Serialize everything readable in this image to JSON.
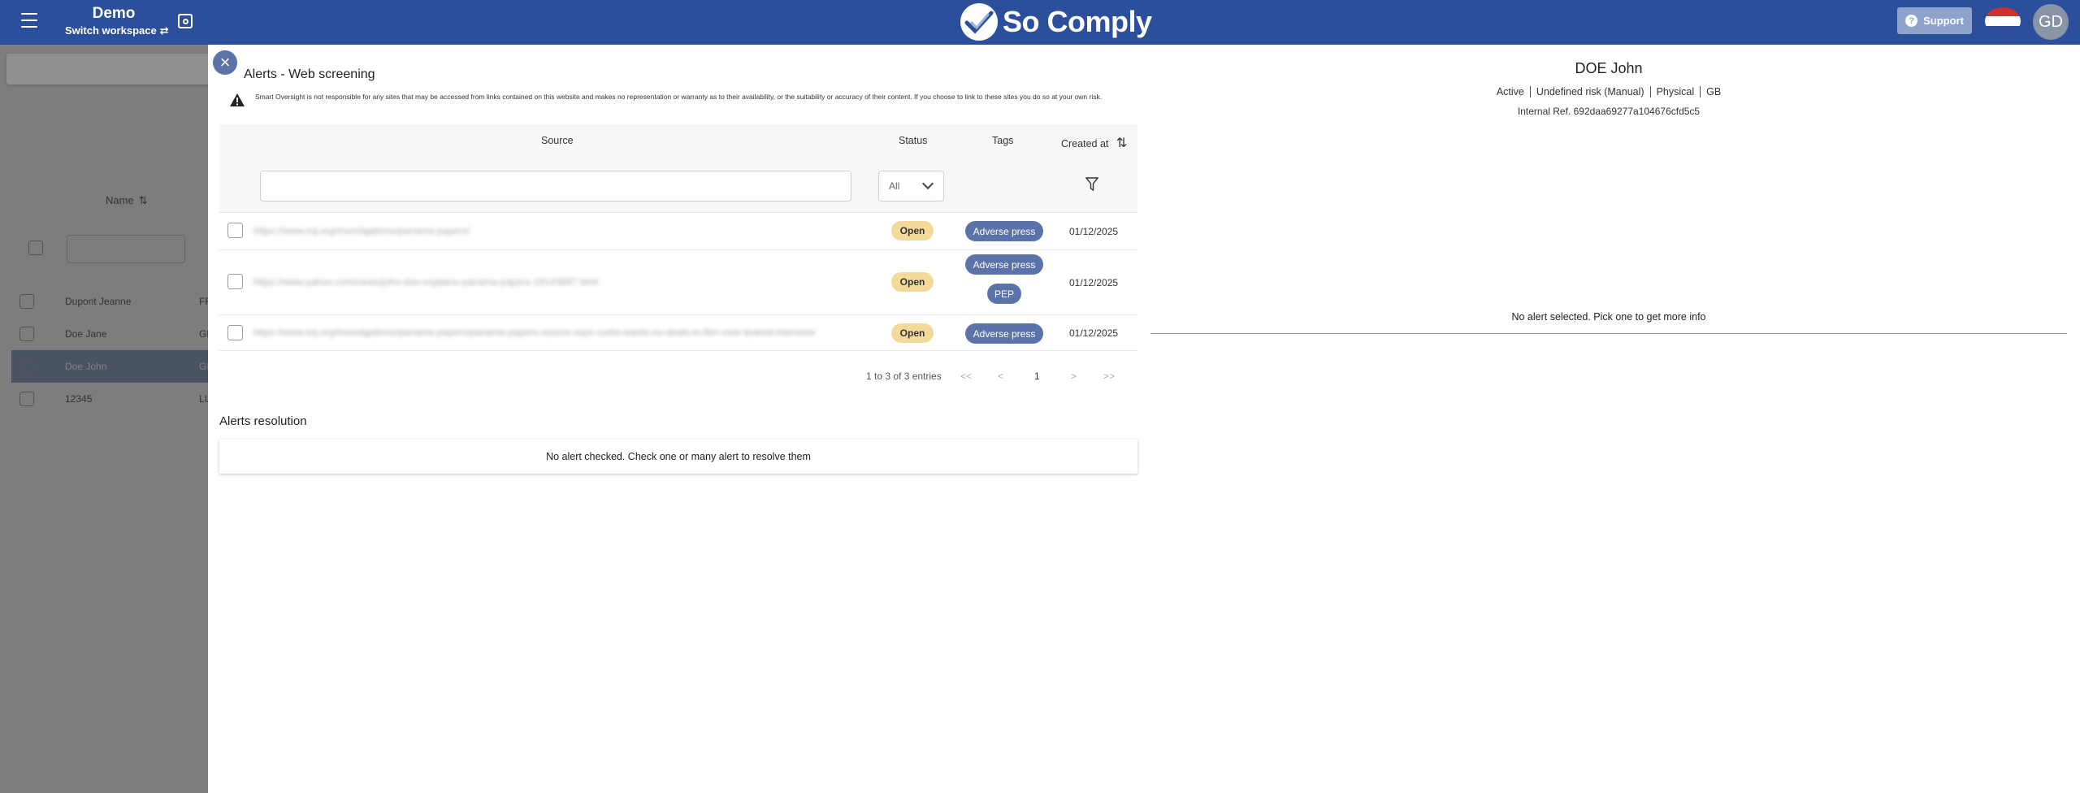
{
  "topbar": {
    "workspace_title": "Demo",
    "switch_label": "Switch workspace",
    "brand": "So Comply",
    "support_label": "Support",
    "avatar_initials": "GD",
    "flag_colors": [
      "#d0312d",
      "#ffffff",
      "#2f4ea0"
    ],
    "bg_color": "#2c4f9b"
  },
  "background_list": {
    "name_header": "Name",
    "rows": [
      {
        "name": "Dupont Jeanne",
        "extra": "FR"
      },
      {
        "name": "Doe Jane",
        "extra": "GB"
      },
      {
        "name": "Doe John",
        "extra": "GB"
      },
      {
        "name": "12345",
        "extra": "LU"
      }
    ]
  },
  "alerts": {
    "title": "Alerts - Web screening",
    "disclaimer": "Smart Oversight is not responsible for any sites that may be accessed from links contained on this website and makes no representation or warranty as to their availability, or the suitability or accuracy of their content. If you choose to link to these sites you do so at your own risk.",
    "columns": {
      "source": "Source",
      "status": "Status",
      "tags": "Tags",
      "created_at": "Created at"
    },
    "status_filter": "All",
    "rows": [
      {
        "source": "https://www.icij.org/investigations/panama-papers/",
        "status": "Open",
        "tags": [
          "Adverse press"
        ],
        "created_at": "01/12/2025"
      },
      {
        "source": "https://www.yahoo.com/news/john-doe-explains-panama-papers-18143687.html",
        "status": "Open",
        "tags": [
          "Adverse press",
          "PEP"
        ],
        "created_at": "01/12/2025"
      },
      {
        "source": "https://www.icij.org/investigations/panama-papers/panama-papers-source-says-curtis-wants-no-deals-in-film-over-leaked-interview",
        "status": "Open",
        "tags": [
          "Adverse press"
        ],
        "created_at": "01/12/2025"
      }
    ],
    "pagination": {
      "summary": "1 to 3 of 3 entries",
      "first": "<<",
      "prev": "<",
      "page": "1",
      "next": ">",
      "last": ">>"
    }
  },
  "resolution": {
    "title": "Alerts resolution",
    "empty_message": "No alert checked. Check one or many alert to resolve them"
  },
  "person": {
    "name": "DOE John",
    "status": "Active",
    "risk": "Undefined risk (Manual)",
    "type": "Physical",
    "country": "GB",
    "internal_ref": "Internal Ref. 692daa69277a104676cfd5c5"
  },
  "detail": {
    "empty_message": "No alert selected. Pick one to get more info"
  }
}
